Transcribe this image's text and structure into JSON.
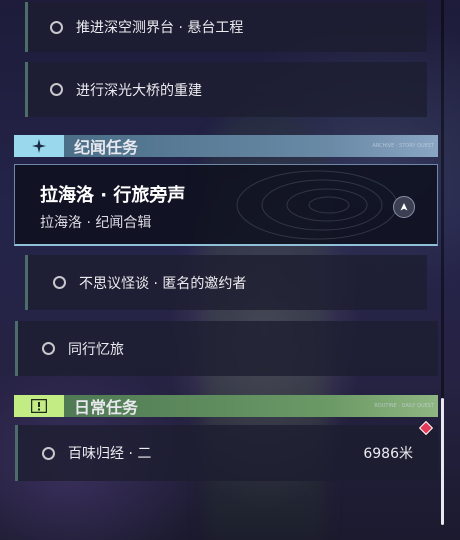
{
  "quests_top": [
    {
      "title": "推进深空测界台 · 悬台工程"
    },
    {
      "title": "进行深光大桥的重建"
    }
  ],
  "story_section": {
    "title": "纪闻任务",
    "tag": "ARCHIVE · STORY QUEST",
    "accent": "#8fd3ea",
    "featured": {
      "title": "拉海洛 · 行旅旁声",
      "subtitle": "拉海洛 · 纪闻合辑",
      "icon": "nav-marker-icon"
    },
    "items": [
      {
        "title": "不思议怪谈 · 匿名的邀约者"
      },
      {
        "title": "同行忆旅"
      }
    ]
  },
  "daily_section": {
    "title": "日常任务",
    "tag": "ROUTINE · DAILY QUEST",
    "accent": "#c4ec84",
    "items": [
      {
        "title": "百味归经 · 二",
        "distance": "6986米",
        "badge_color": "#e23a58"
      }
    ]
  }
}
